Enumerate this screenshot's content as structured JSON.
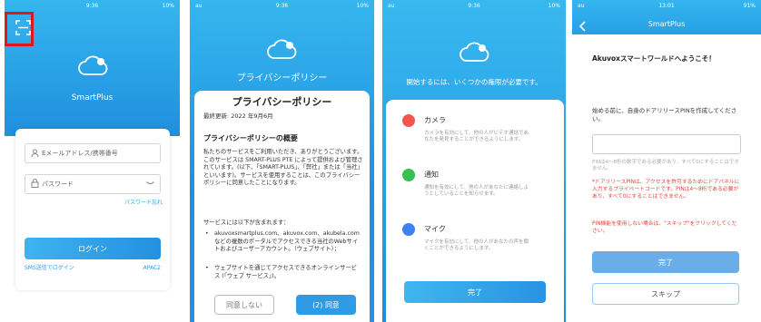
{
  "screen1": {
    "status_time": "9:36",
    "status_right": "10%",
    "app_name": "SmartPlus",
    "email_placeholder": "Eメールアドレス/携帯番号",
    "password_placeholder": "パスワード",
    "forgot_password": "パスワード忘れ",
    "login_button": "ログイン",
    "sms_login": "SMS送信でログイン",
    "region": "APAC2",
    "icons": [
      "scan-icon",
      "cloud-bell-icon",
      "person-icon",
      "lock-icon",
      "eye-icon"
    ]
  },
  "screen2": {
    "status_left": "au",
    "status_time": "9:36",
    "status_right": "10%",
    "header_title": "プライバシーポリシー",
    "sheet_title": "プライバシーポリシー",
    "updated": "最終更新: 2022 年9月6月",
    "section_title": "プライバシーポリシーの概要",
    "para1": "私たちのサービスをご利用いただき、ありがとうございます。このサービスは SMART-PLUS PTE によって提供および管理されています。(以下、「SMART-PLUS」、「弊社」または「当社」といいます)。サービスを使用することは、このプライバシーポリシーに同意したことになります。",
    "para2": "サービスには以下が含まれます：",
    "bullet1": "akuvoxsmartplus.com、akuvox.com、akubela.com などの複数のポータルでアクセスできる当社のWebサイトおよびユーザーアカウント。（ウェブサイト）；",
    "bullet2": "ウェブサイトを通じてアクセスできるオンラインサービス (「ウェブ サービス」)。",
    "decline_button": "同意しない",
    "agree_button": "(2) 同意"
  },
  "screen3": {
    "status_left": "au",
    "status_time": "9:36",
    "status_right": "10%",
    "intro": "開始するには、いくつかの権限が必要です。",
    "permissions": [
      {
        "name": "カメラ",
        "desc": "カメラを有効にして、他の人がビデオ通話であなたを発見することができるようにします。",
        "color": "#f0574d"
      },
      {
        "name": "通知",
        "desc": "通知を有効にして、他の人があなたに連絡しようとしていることを知らせます。",
        "color": "#35c24e"
      },
      {
        "name": "マイク",
        "desc": "マイクを有効にして、他の人があなたの声を聞くことができるようにします。",
        "color": "#3e82f0"
      }
    ],
    "done_button": "完了"
  },
  "screen4": {
    "status_left": "au",
    "status_time": "13:01",
    "status_right": "91%",
    "header_title": "SmartPlus",
    "welcome": "Akuvoxスマートワールドへようこそ！",
    "prompt": "始める前に、自身のドアリリースPINを作成してください。",
    "pin_value": "",
    "pin_note": "PINは4～8桁の数字である必要があり、すべて0にすることはできません。",
    "warning": "*ドアリリースPINは、アクセスを許可するためにドアパネルに入力するプライベートコードです。PINは4～8桁である必要があり、すべて0にすることはできません。",
    "skip_note": "PIN機能を使用しない場合は、\"スキップ\"をクリックしてください。",
    "done_button": "完了",
    "skip_button": "スキップ"
  }
}
